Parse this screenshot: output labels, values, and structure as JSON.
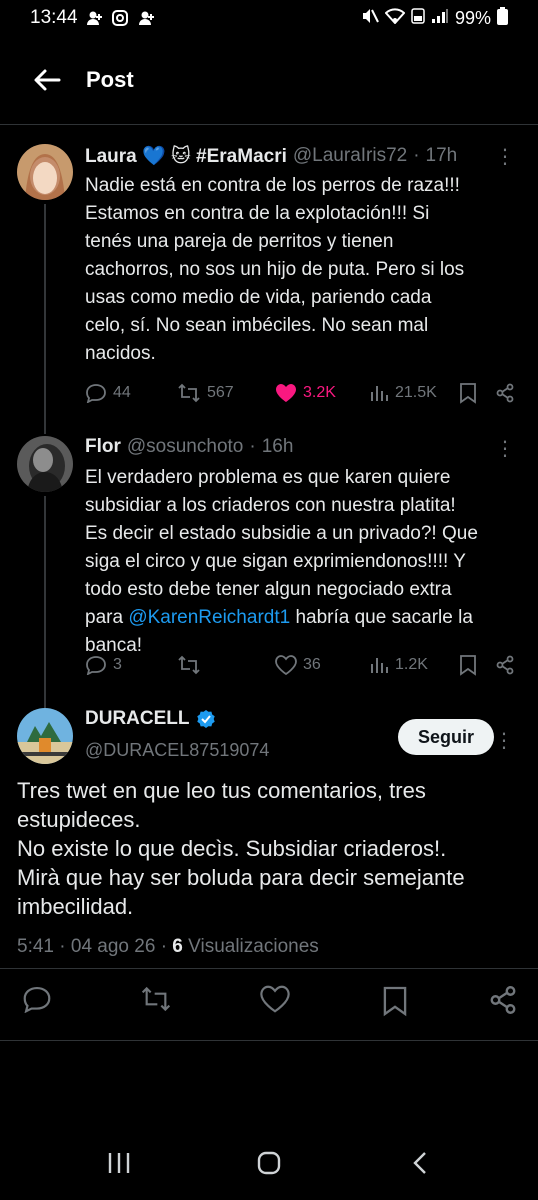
{
  "status_bar": {
    "time": "13:44",
    "battery": "99%"
  },
  "header": {
    "title": "Post"
  },
  "tweets": [
    {
      "name": "Laura 💙 🐱 #EraMacri",
      "handle": "@LauraIris72",
      "time": "17h",
      "text": "Nadie está en contra de los perros de raza!!!\nEstamos en contra de la explotación!!! Si\ntenés una pareja de perritos y tienen\ncachorros, no sos un hijo de puta. Pero si los\nusas como medio de vida, pariendo cada\ncelo, sí. No sean imbéciles. No sean mal\nnacidos.",
      "replies": "44",
      "reposts": "567",
      "likes": "3.2K",
      "views": "21.5K"
    },
    {
      "name": "Flor",
      "handle": "@sosunchoto",
      "time": "16h",
      "text_before": "El verdadero problema es que karen quiere\nsubsidiar a los criaderos con nuestra platita!\nEs decir el estado subsidie a un privado?! Que\nsiga el circo y que sigan exprimiendonos!!!!  Y\ntodo esto debe tener algun negociado extra\npara ",
      "mention": "@KarenReichardt1",
      "text_after": " habría que sacarle la\nbanca!",
      "replies": "3",
      "reposts": "",
      "likes": "36",
      "views": "1.2K"
    }
  ],
  "main_post": {
    "name": "DURACELL",
    "handle": "@DURACEL87519074",
    "follow_label": "Seguir",
    "text": "Tres twet en que leo tus comentarios, tres\nestupideces.\nNo existe lo que decìs. Subsidiar criaderos!.\nMirà que hay ser boluda para decir semejante\nimbecilidad.",
    "time": "5:41",
    "date": "04 ago 26",
    "views_count": "6",
    "views_label": "Visualizaciones"
  },
  "colors": {
    "like_active": "#f91880",
    "mention": "#1d9bf0",
    "verified": "#1d9bf0",
    "muted": "#71767b"
  }
}
